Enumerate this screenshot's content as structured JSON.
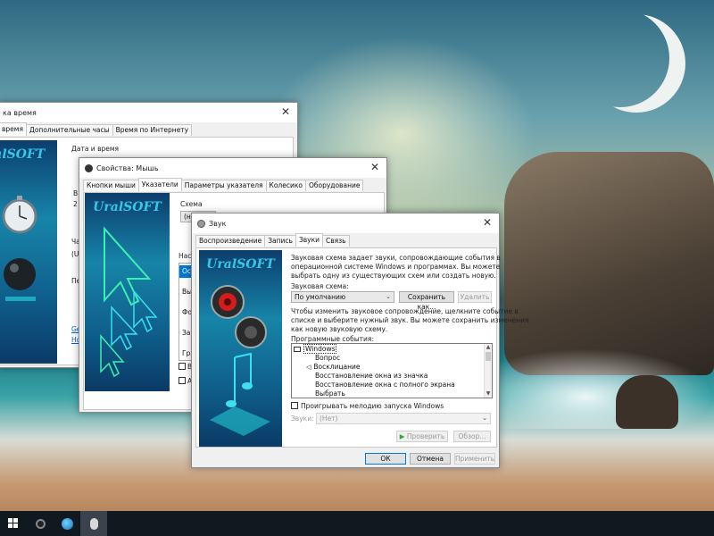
{
  "datetime_window": {
    "title": "Дата и время",
    "title_visible": "ка время",
    "tabs": [
      "время",
      "Дополнительные часы",
      "Время по Интернету"
    ],
    "section_label": "Дата и время",
    "brand": "UralSOFT",
    "frag_labels": [
      "В",
      "2",
      "Ча",
      "(U",
      "Пе",
      "Ge",
      "Ho"
    ]
  },
  "mouse_window": {
    "title": "Свойства: Мышь",
    "tabs": [
      "Кнопки мыши",
      "Указатели",
      "Параметры указателя",
      "Колесико",
      "Оборудование"
    ],
    "active_tab": "Указатели",
    "brand": "UralSOFT",
    "scheme_label": "Схема",
    "scheme_value": "(не",
    "settings_label": "Настр",
    "list_items": [
      "Осно",
      "Выбо",
      "Фон",
      "Заня",
      "Граф"
    ],
    "check1": "Вк",
    "check2": "Allo"
  },
  "sound_window": {
    "title": "Звук",
    "tabs": [
      "Воспроизведение",
      "Запись",
      "Звуки",
      "Связь"
    ],
    "active_tab": "Звуки",
    "brand": "UralSOFT",
    "description": [
      "Звуковая схема задает звуки, сопровождающие события в",
      "операционной системе Windows и программах. Вы можете",
      "выбрать одну из существующих схем или создать новую."
    ],
    "scheme_label": "Звуковая схема:",
    "scheme_value": "По умолчанию",
    "save_as_button": "Сохранить как...",
    "delete_button": "Удалить",
    "instructions": [
      "Чтобы изменить звуковое сопровождение, щелкните событие в",
      "списке и выберите нужный звук. Вы можете сохранить изменения",
      "как новую звуковую схему."
    ],
    "events_label": "Программные события:",
    "events": [
      {
        "label": "Windows",
        "level": 0,
        "selected": true,
        "icon": "computer-icon"
      },
      {
        "label": "Вопрос",
        "level": 1,
        "selected": false,
        "icon": ""
      },
      {
        "label": "Восклицание",
        "level": 1,
        "selected": false,
        "icon": "speaker-icon"
      },
      {
        "label": "Восстановление окна из значка",
        "level": 1,
        "selected": false,
        "icon": ""
      },
      {
        "label": "Восстановление окна с полного экрана",
        "level": 1,
        "selected": false,
        "icon": ""
      },
      {
        "label": "Выбрать",
        "level": 1,
        "selected": false,
        "icon": ""
      }
    ],
    "startup_checkbox": "Проигрывать мелодию запуска Windows",
    "sounds_label": "Звуки:",
    "sounds_value": "(Нет)",
    "test_button": "Проверить",
    "browse_button": "Обзор...",
    "ok_button": "ОК",
    "cancel_button": "Отмена",
    "apply_button": "Применить"
  },
  "colors": {
    "accent": "#0078d7",
    "brand_text": "#37c7e6",
    "art_bg": "#1784a8",
    "taskbar": "#101820"
  }
}
